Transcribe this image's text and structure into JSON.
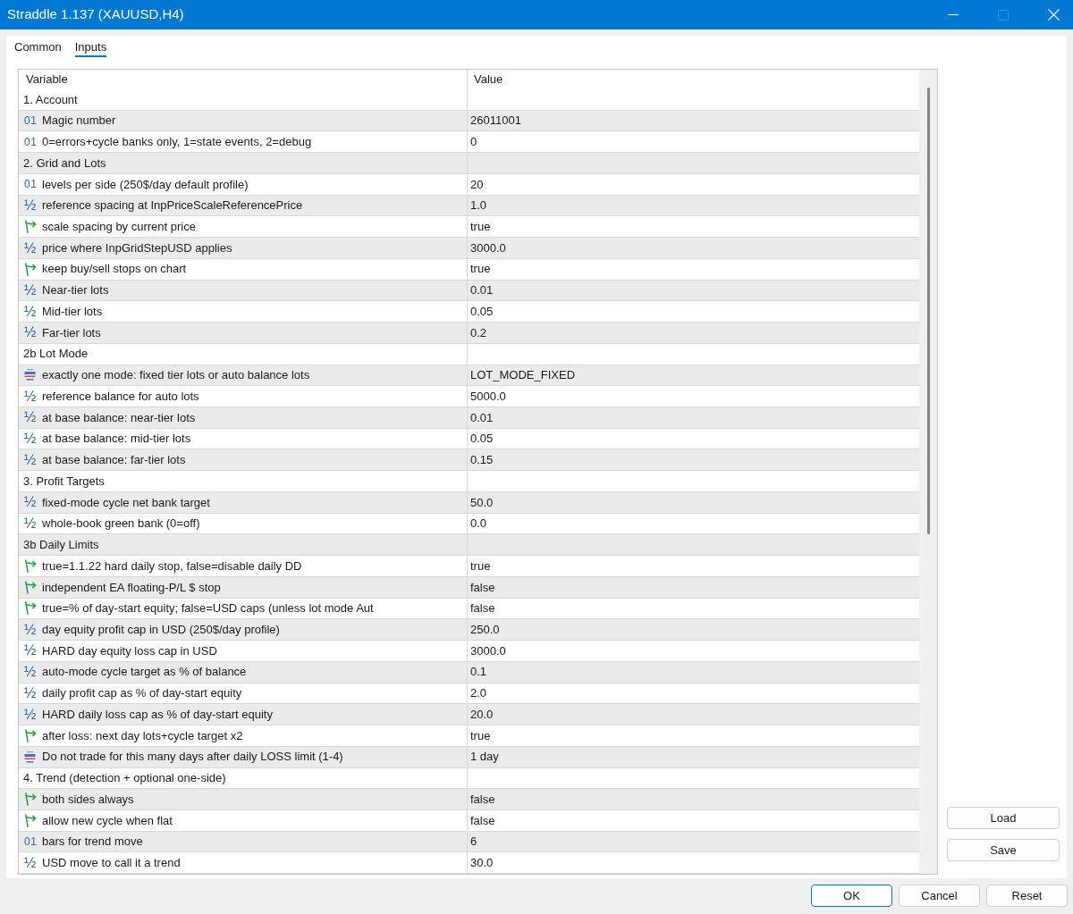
{
  "window": {
    "title": "Straddle 1.137 (XAUUSD,H4)",
    "controls": [
      {
        "kind": "minimize",
        "disabled": false
      },
      {
        "kind": "maximize",
        "disabled": true
      },
      {
        "kind": "close",
        "disabled": false
      }
    ]
  },
  "tabs": [
    {
      "label": "Common",
      "selected": false
    },
    {
      "label": "Inputs",
      "selected": true
    }
  ],
  "table": {
    "columns": [
      "Variable",
      "Value"
    ],
    "rows": [
      {
        "kind": "section",
        "variable": "1. Account"
      },
      {
        "kind": "int",
        "glyph": "01",
        "variable": "Magic number",
        "value": "26011001"
      },
      {
        "kind": "int",
        "glyph": "01",
        "variable": "0=errors+cycle banks only, 1=state events, 2=debug",
        "value": "0"
      },
      {
        "kind": "section",
        "variable": "2. Grid and Lots"
      },
      {
        "kind": "int",
        "glyph": "01",
        "variable": "levels per side (250$/day default profile)",
        "value": "20"
      },
      {
        "kind": "double",
        "glyph": "½",
        "variable": "reference spacing at InpPriceScaleReferencePrice",
        "value": "1.0"
      },
      {
        "kind": "bool",
        "variable": "scale spacing by current price",
        "value": "true"
      },
      {
        "kind": "double",
        "glyph": "½",
        "variable": "price where InpGridStepUSD applies",
        "value": "3000.0"
      },
      {
        "kind": "bool",
        "variable": "keep buy/sell stops on chart",
        "value": "true"
      },
      {
        "kind": "double",
        "glyph": "½",
        "variable": "Near-tier lots",
        "value": "0.01"
      },
      {
        "kind": "double",
        "glyph": "½",
        "variable": "Mid-tier lots",
        "value": "0.05"
      },
      {
        "kind": "double",
        "glyph": "½",
        "variable": "Far-tier lots",
        "value": "0.2"
      },
      {
        "kind": "section",
        "variable": "2b Lot Mode"
      },
      {
        "kind": "enum",
        "variable": "exactly one mode: fixed tier lots or auto balance lots",
        "value": "LOT_MODE_FIXED"
      },
      {
        "kind": "double",
        "glyph": "½",
        "variable": "reference balance for auto lots",
        "value": "5000.0"
      },
      {
        "kind": "double",
        "glyph": "½",
        "variable": "at base balance: near-tier lots",
        "value": "0.01"
      },
      {
        "kind": "double",
        "glyph": "½",
        "variable": "at base balance: mid-tier lots",
        "value": "0.05"
      },
      {
        "kind": "double",
        "glyph": "½",
        "variable": "at base balance: far-tier lots",
        "value": "0.15"
      },
      {
        "kind": "section",
        "variable": "3. Profit Targets"
      },
      {
        "kind": "double",
        "glyph": "½",
        "variable": "fixed-mode cycle net bank target",
        "value": "50.0"
      },
      {
        "kind": "double",
        "glyph": "½",
        "variable": "whole-book green bank (0=off)",
        "value": "0.0"
      },
      {
        "kind": "section",
        "variable": "3b Daily Limits"
      },
      {
        "kind": "bool",
        "variable": "true=1.1.22 hard daily stop, false=disable daily DD",
        "value": "true"
      },
      {
        "kind": "bool",
        "variable": "independent EA floating-P/L $ stop",
        "value": "false"
      },
      {
        "kind": "bool",
        "variable": "true=% of day-start equity; false=USD caps (unless lot mode Aut",
        "value": "false"
      },
      {
        "kind": "double",
        "glyph": "½",
        "variable": "day equity profit cap in USD (250$/day profile)",
        "value": "250.0"
      },
      {
        "kind": "double",
        "glyph": "½",
        "variable": "HARD day equity loss cap in USD",
        "value": "3000.0"
      },
      {
        "kind": "double",
        "glyph": "½",
        "variable": "auto-mode cycle target as % of balance",
        "value": "0.1"
      },
      {
        "kind": "double",
        "glyph": "½",
        "variable": "daily profit cap as % of day-start equity",
        "value": "2.0"
      },
      {
        "kind": "double",
        "glyph": "½",
        "variable": "HARD daily loss cap as % of day-start equity",
        "value": "20.0"
      },
      {
        "kind": "bool",
        "variable": "after loss: next day lots+cycle target x2",
        "value": "true"
      },
      {
        "kind": "enum",
        "variable": "Do not trade for this many days after daily LOSS limit (1-4)",
        "value": "1 day"
      },
      {
        "kind": "section",
        "variable": "4. Trend (detection + optional one-side)"
      },
      {
        "kind": "bool",
        "variable": "both sides always",
        "value": "false"
      },
      {
        "kind": "bool",
        "variable": "allow new cycle when flat",
        "value": "false"
      },
      {
        "kind": "int",
        "glyph": "01",
        "variable": "bars for trend move",
        "value": "6"
      },
      {
        "kind": "double",
        "glyph": "½",
        "variable": "USD move to call it a trend",
        "value": "30.0"
      }
    ]
  },
  "side_buttons": [
    "Load",
    "Save"
  ],
  "buttons": [
    {
      "label": "OK",
      "default": true
    },
    {
      "label": "Cancel",
      "default": false
    },
    {
      "label": "Reset",
      "default": false
    }
  ]
}
